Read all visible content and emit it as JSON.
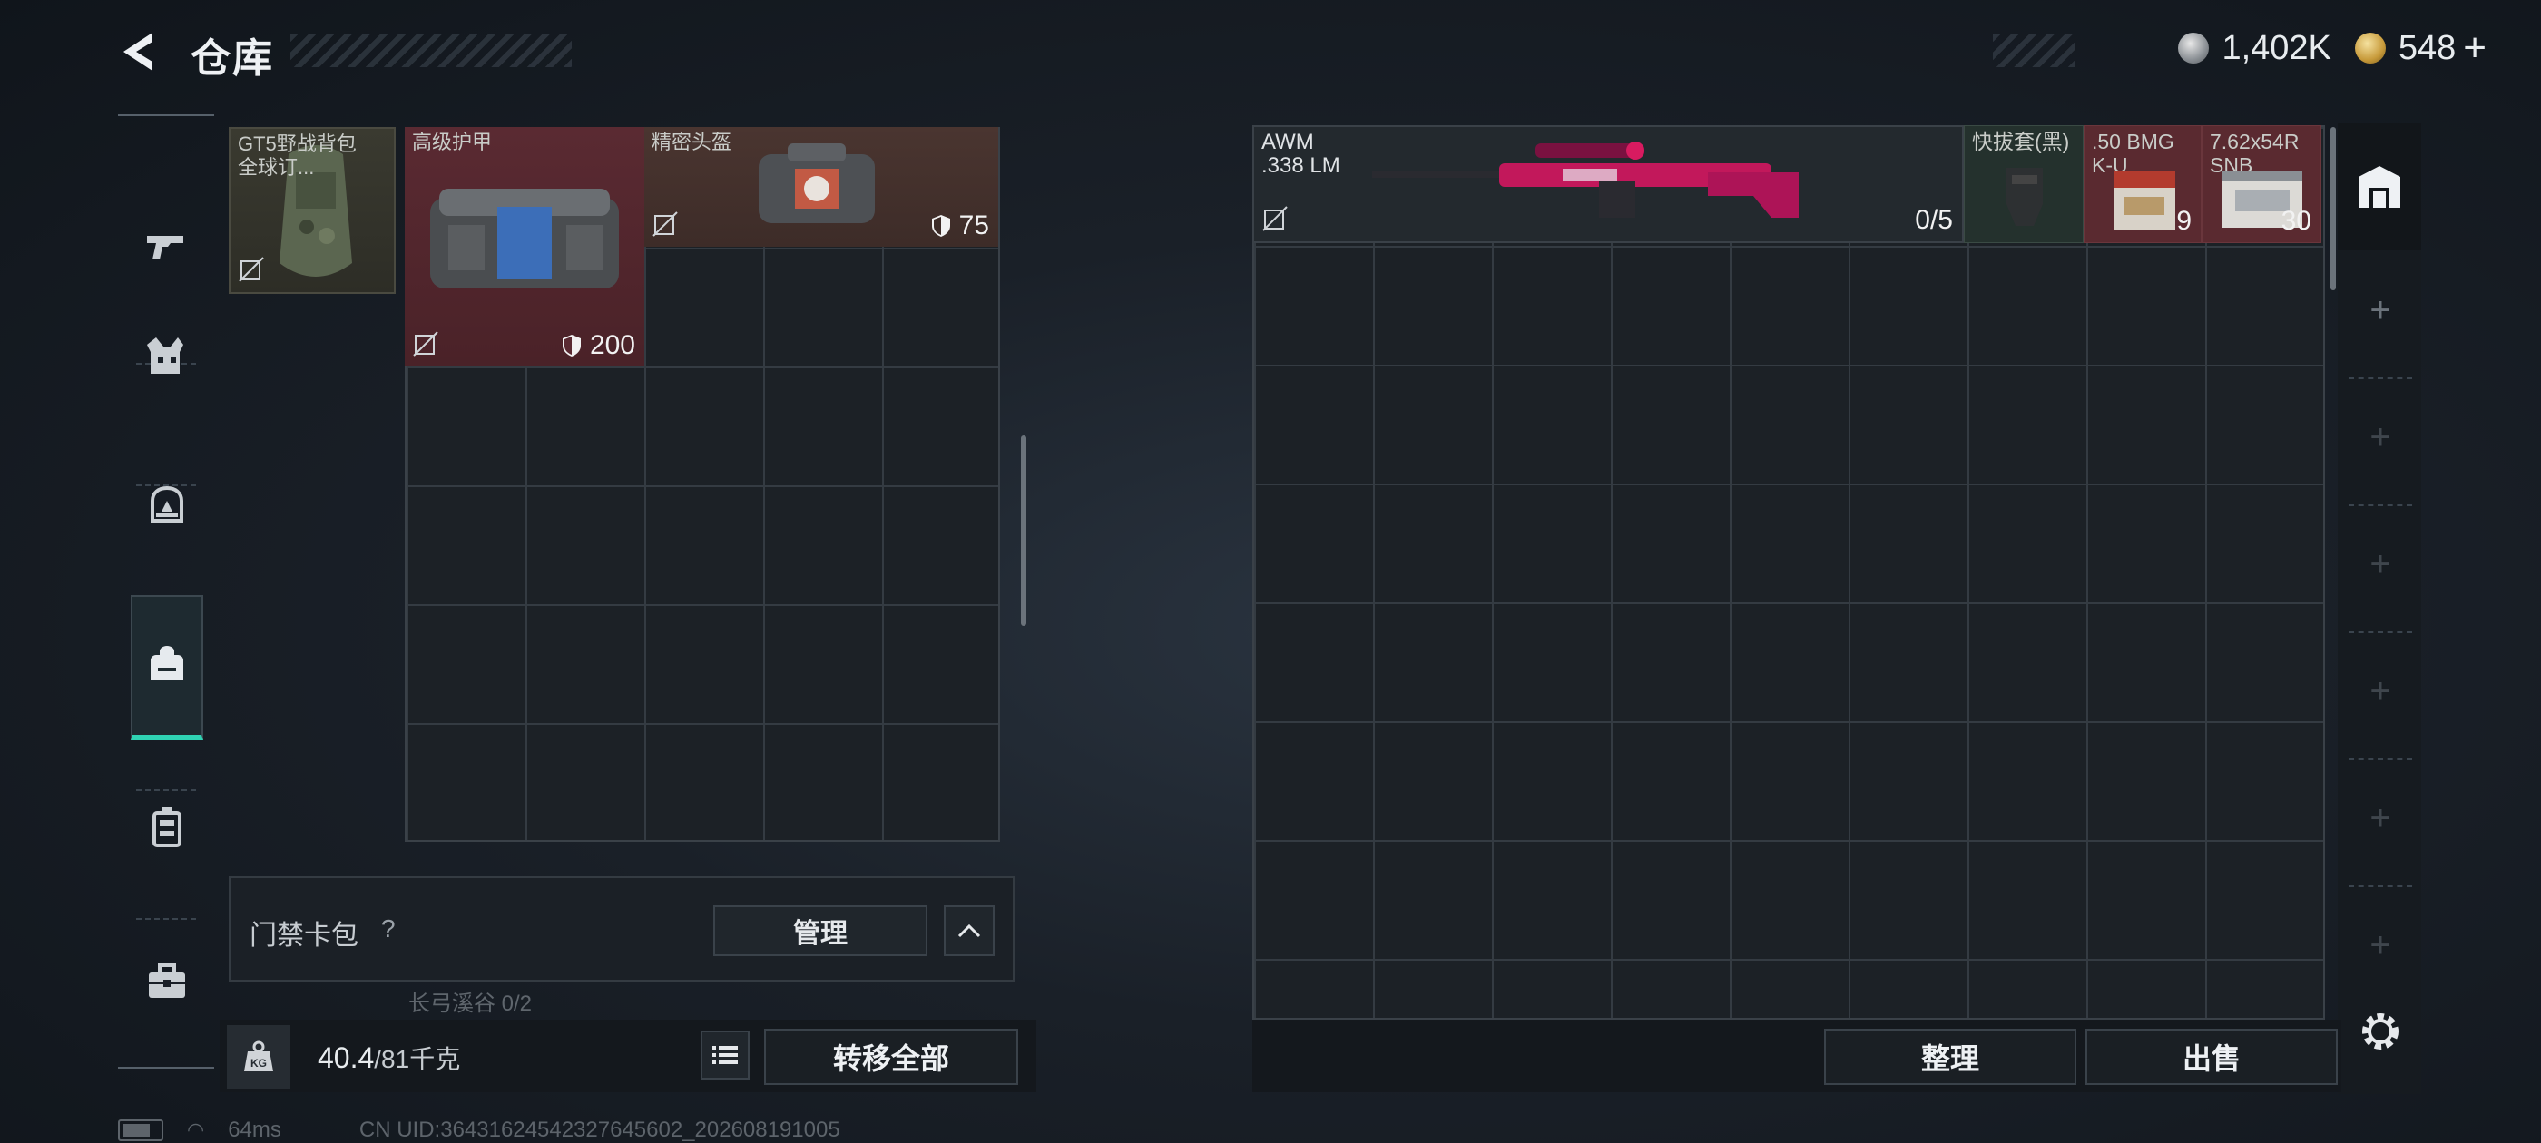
{
  "header": {
    "title": "仓库",
    "currencies": [
      {
        "name": "silver-coin-icon",
        "amount": "1,402K"
      },
      {
        "name": "gold-coin-icon",
        "amount": "548",
        "suffix": "+"
      }
    ]
  },
  "nav": {
    "items": [
      {
        "name": "weapon",
        "icon": "pistol-icon",
        "active": false
      },
      {
        "name": "armor",
        "icon": "vest-icon",
        "active": false
      },
      {
        "name": "helmet",
        "icon": "helmet-icon",
        "active": false
      },
      {
        "name": "backpack",
        "icon": "backpack-icon",
        "active": true
      },
      {
        "name": "chest-rig",
        "icon": "rig-icon",
        "active": false
      },
      {
        "name": "case",
        "icon": "briefcase-icon",
        "active": false
      }
    ]
  },
  "loadout": {
    "backpack": {
      "label": "GT5野战背包\n全球订..."
    },
    "vest": {
      "label": "高级护甲",
      "durability": "200"
    },
    "helmet": {
      "label": "精密头盔",
      "durability": "75"
    }
  },
  "access_card": {
    "label": "门禁卡包",
    "help": "?",
    "manage_label": "管理",
    "sub_label": "长弓溪谷  0/2"
  },
  "weight": {
    "current": "40.4",
    "max_unit": "/81千克",
    "transfer_all_label": "转移全部"
  },
  "stash": {
    "weapon": {
      "name": "AWM",
      "caliber": ".338 LM",
      "ammo": "0/5"
    },
    "items": [
      {
        "label": "快拔套(黑)",
        "count": ""
      },
      {
        "label": ".50 BMG\nK-U",
        "count": "9"
      },
      {
        "label": "7.62x54R\nSNB",
        "count": "30"
      }
    ],
    "sort_label": "整理",
    "sell_label": "出售"
  },
  "status_bar": {
    "ping": "64ms",
    "uid": "CN UID:36431624542327645602_202608191005"
  },
  "colors": {
    "accent": "#2fd3b3",
    "red_rarity": "#5a2a30",
    "green_rarity": "#24312d"
  }
}
